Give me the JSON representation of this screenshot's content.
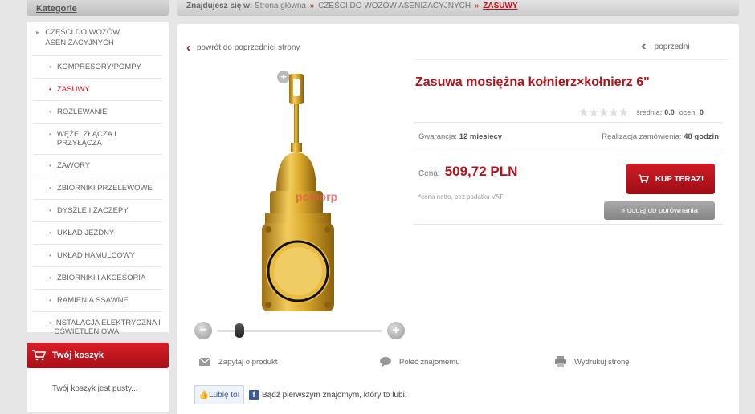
{
  "sidebar": {
    "categories_header": "Kategorie",
    "parent_category": "CZĘŚCI DO WOZÓW ASENIZACYJNYCH",
    "items": [
      {
        "label": "KOMPRESORY/POMPY"
      },
      {
        "label": "ZASUWY"
      },
      {
        "label": "ROZLEWANIE"
      },
      {
        "label": "WĘŻE, ZŁĄCZA I PRZYŁĄCZA"
      },
      {
        "label": "ZAWORY"
      },
      {
        "label": "ZBIORNIKI PRZELEWOWE"
      },
      {
        "label": "DYSZLE I ZACZEPY"
      },
      {
        "label": "UKŁAD JEZDNY"
      },
      {
        "label": "UKŁAD HAMULCOWY"
      },
      {
        "label": "ZBIORNIKI I AKCESORIA"
      },
      {
        "label": "RAMIENIA SSAWNE"
      },
      {
        "label": "INSTALACJA ELEKTRYCZNA I OŚWIETLENIOWA"
      }
    ],
    "active_index": 1,
    "cart": {
      "title": "Twój koszyk",
      "empty_text": "Twój koszyk jest pusty..."
    }
  },
  "breadcrumb": {
    "prefix": "Znajdujesz się w:",
    "home": "Strona główna",
    "category": "CZĘŚCI DO WOZÓW ASENIZACYJNYCH",
    "current": "ZASUWY"
  },
  "nav": {
    "back": "powrót do poprzedniej strony",
    "previous": "poprzedni"
  },
  "product": {
    "title": "Zasuwa mosiężna kołnierz×kołnierz 6\"",
    "rating": {
      "stars_filled": 0,
      "stars_total": 5,
      "avg_label": "średnia:",
      "avg_value": "0.0",
      "votes_label": "ocen:",
      "votes_value": "0"
    },
    "warranty_label": "Gwarancja:",
    "warranty_value": "12 miesięcy",
    "fulfillment_label": "Realizacja zamówienia:",
    "fulfillment_value": "48 godzin",
    "price_label": "Cena:",
    "price_value": "509,72 PLN",
    "vat_note": "*cena netto, bez podatku VAT",
    "buy_label": "KUP TERAZ!",
    "compare_label": "» dodaj do porównania",
    "watermark": "pomorp"
  },
  "actions": {
    "ask": "Zapytaj o produkt",
    "recommend": "Poleć znajomemu",
    "print": "Wydrukuj stronę"
  },
  "social": {
    "like_label": "Lubię to!",
    "fb_text": "Bądź pierwszym znajomym, który to lubi."
  },
  "colors": {
    "accent": "#b3121b",
    "brass": "#d9a82c"
  },
  "icons": {
    "cart": "cart-icon",
    "mail": "mail-icon",
    "recommend": "speech-bubble-icon",
    "print": "printer-icon",
    "thumb": "thumbs-up-icon",
    "facebook": "facebook-icon"
  }
}
